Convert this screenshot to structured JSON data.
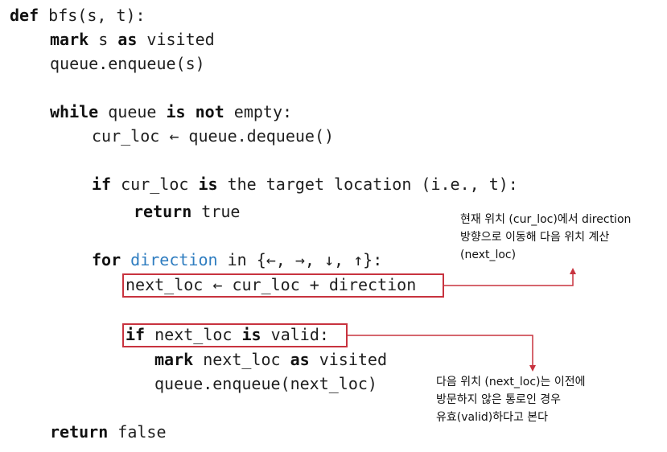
{
  "code": {
    "l1": {
      "a": "def",
      "b": " bfs(s, t):"
    },
    "l2": {
      "a": "mark",
      "b": " s ",
      "c": "as",
      "d": " visited"
    },
    "l3": {
      "a": "queue.enqueue(s)"
    },
    "l4": {
      "a": "while",
      "b": " queue ",
      "c": "is not",
      "d": " empty:"
    },
    "l5": {
      "a": "cur_loc ← queue.dequeue()"
    },
    "l6": {
      "a": "if",
      "b": " cur_loc ",
      "c": "is",
      "d": " the target location (i.e., t):"
    },
    "l7": {
      "a": "return",
      "b": " true"
    },
    "l8": {
      "a": "for",
      "b": " ",
      "c": "direction",
      "d": " in {←, →, ↓, ↑}:"
    },
    "l9": {
      "a": "next_loc ← cur_loc + direction"
    },
    "l10": {
      "a": "if",
      "b": " next_loc ",
      "c": "is",
      "d": " valid:"
    },
    "l11": {
      "a": "mark",
      "b": " next_loc ",
      "c": "as",
      "d": " visited"
    },
    "l12": {
      "a": "queue.enqueue(next_loc)"
    },
    "l13": {
      "a": "return",
      "b": " false"
    }
  },
  "annotations": {
    "direction_note": "현재 위치 (cur_loc)에서 direction\n방향으로 이동해 다음 위치 계산\n(next_loc)",
    "valid_note": "다음 위치 (next_loc)는 이전에\n방문하지 않은 통로인 경우\n유효(valid)하다고 본다"
  },
  "colors": {
    "highlight": "#c8333f",
    "keyword_direction": "#2f7dc0"
  }
}
